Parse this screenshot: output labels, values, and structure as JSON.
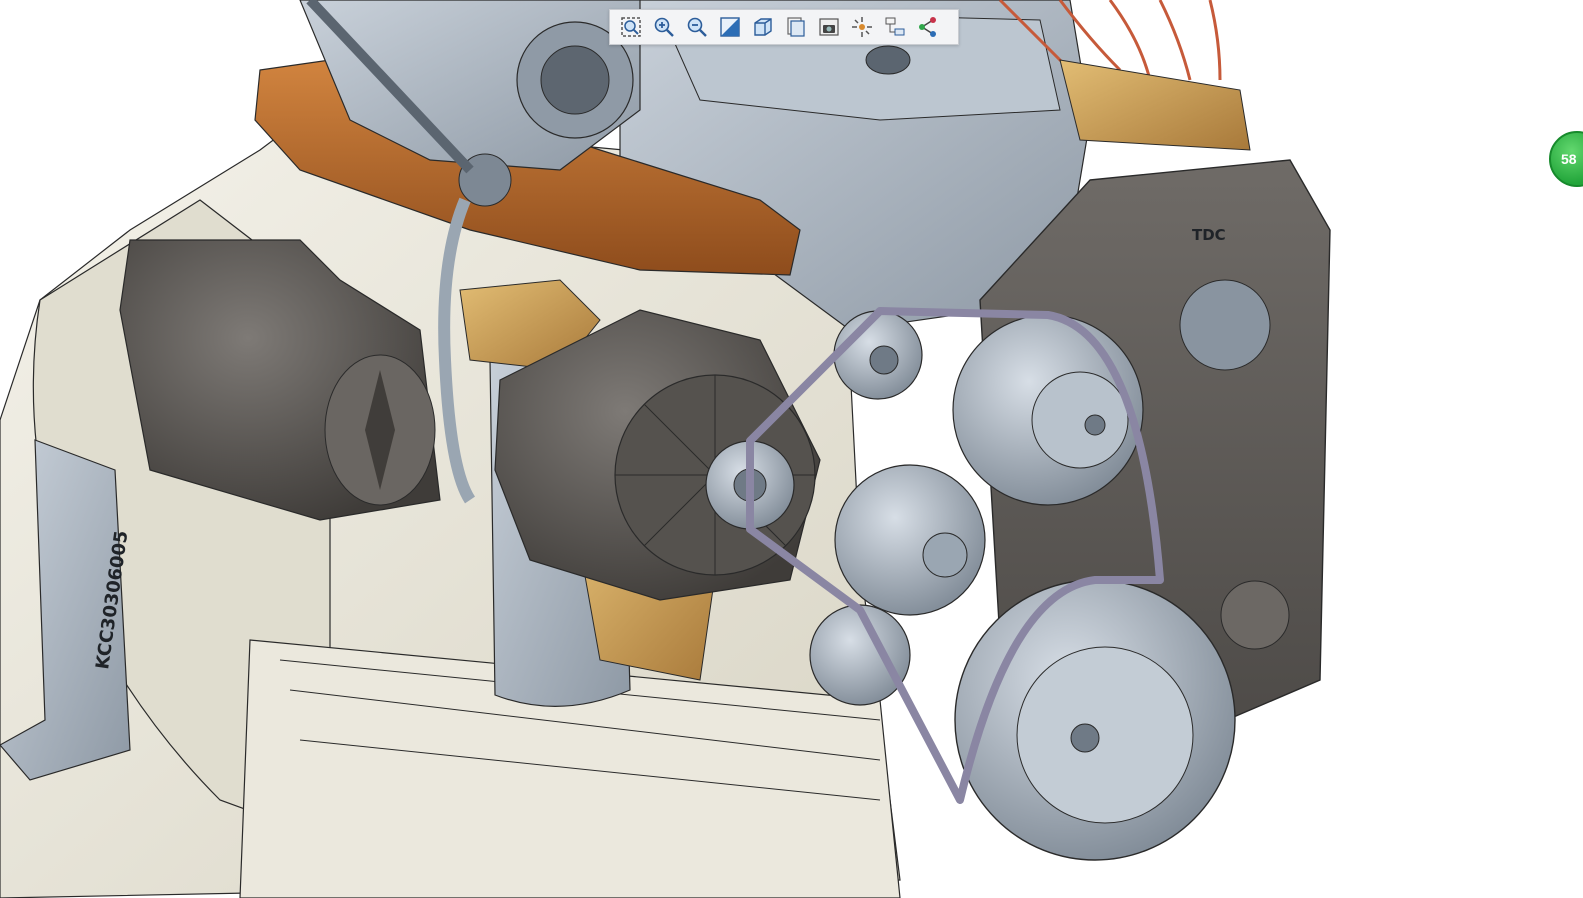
{
  "viewer": {
    "toolbar": [
      {
        "id": "zoom-fit",
        "icon": "zoom-fit-icon"
      },
      {
        "id": "zoom-in",
        "icon": "zoom-in-icon"
      },
      {
        "id": "zoom-out",
        "icon": "zoom-out-icon"
      },
      {
        "id": "shading",
        "icon": "shading-icon"
      },
      {
        "id": "view-cube",
        "icon": "view-orientation-icon"
      },
      {
        "id": "saved-views",
        "icon": "saved-views-icon"
      },
      {
        "id": "snapshot",
        "icon": "camera-icon"
      },
      {
        "id": "explode",
        "icon": "explode-icon"
      },
      {
        "id": "model-tree",
        "icon": "model-tree-icon"
      },
      {
        "id": "share",
        "icon": "share-icon"
      }
    ],
    "badge_text": "58"
  },
  "model": {
    "timing_cover_label": "TDC",
    "bracket_engraving": "KCC30306005"
  },
  "colors": {
    "background": "#ffffff",
    "block": "#e9e6da",
    "steel": "#aab4bf",
    "dark_grey": "#5d5a56",
    "copper": "#b66a2c",
    "brass": "#caa15c",
    "belt": "#8a86a3",
    "line": "#2a2a2a",
    "badge": "#2fbf47"
  }
}
